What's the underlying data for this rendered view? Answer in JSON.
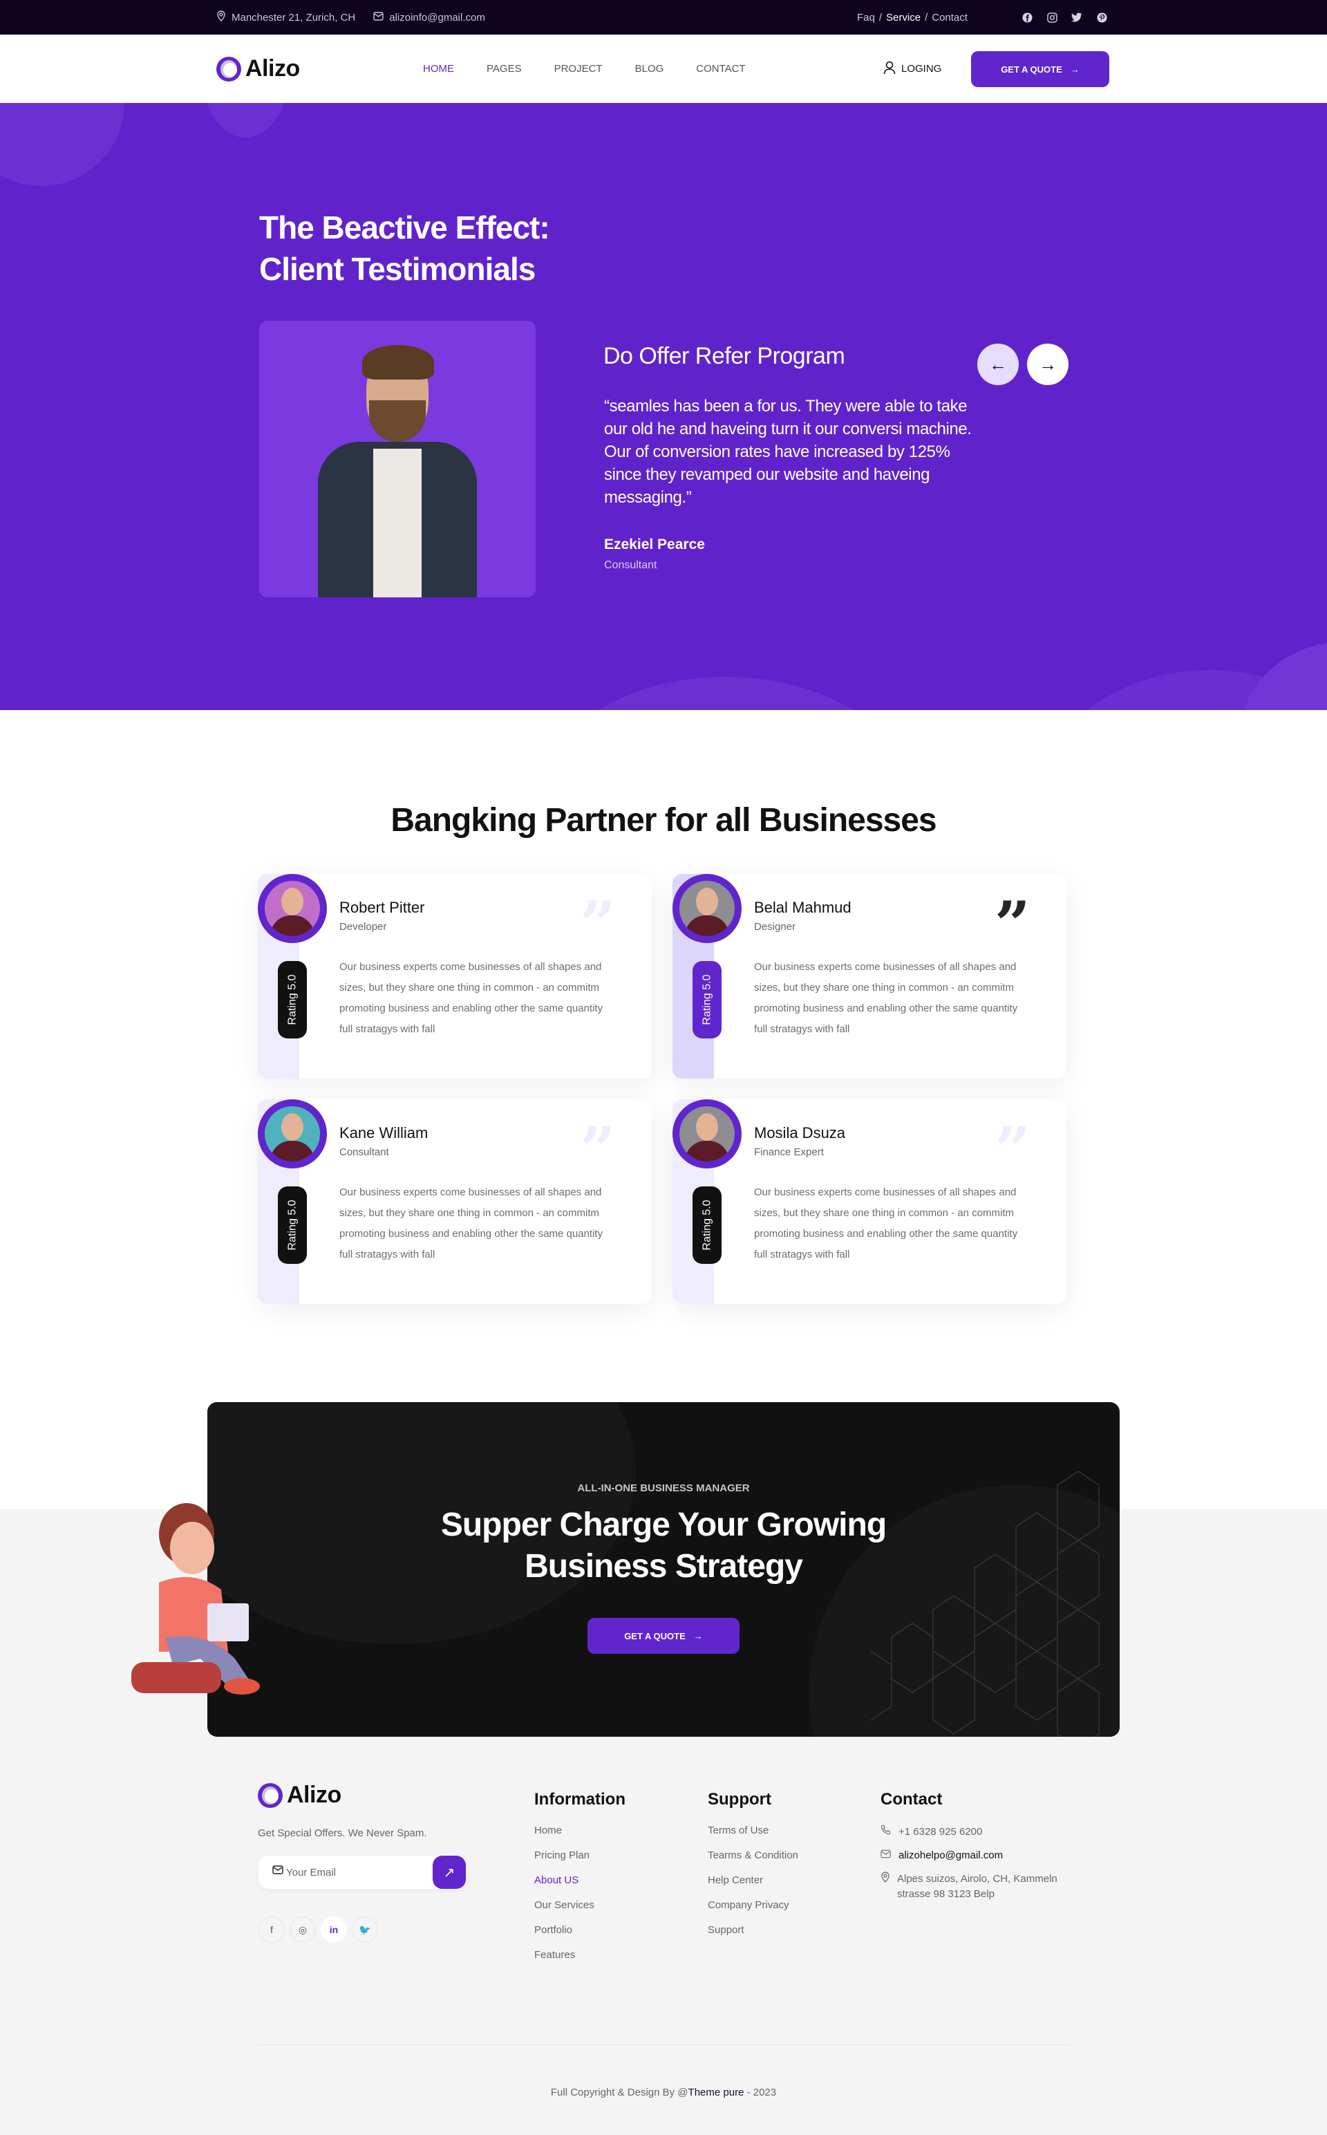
{
  "topbar": {
    "address": "Manchester 21, Zurich, CH",
    "email": "alizoinfo@gmail.com",
    "links": [
      {
        "label": "Faq",
        "active": false
      },
      {
        "label": "Service",
        "active": true
      },
      {
        "label": "Contact",
        "active": false
      }
    ],
    "separator": "/",
    "social_icons": [
      "facebook-icon",
      "instagram-icon",
      "twitter-icon",
      "pinterest-icon"
    ]
  },
  "header": {
    "logo": "Alizo",
    "nav": [
      {
        "label": "HOME",
        "active": true
      },
      {
        "label": "PAGES",
        "active": false
      },
      {
        "label": "PROJECT",
        "active": false
      },
      {
        "label": "BLOG",
        "active": false
      },
      {
        "label": "CONTACT",
        "active": false
      }
    ],
    "login_label": "LOGING",
    "quote_label": "GET A QUOTE"
  },
  "hero": {
    "title_line1": "The Beactive Effect:",
    "title_line2": "Client Testimonials",
    "prev_icon": "←",
    "next_icon": "→",
    "quote_title": "Do Offer Refer Program",
    "quote_text": "“seamles has been a for us. They were able to take our old he and haveing turn it our conversi machine. Our of conversion rates have increased by 125% since they revamped our website and haveing messaging.”",
    "author_name": "Ezekiel Pearce",
    "author_role": "Consultant"
  },
  "partners": {
    "title": "Bangking Partner for all Businesses",
    "cards": [
      {
        "name": "Robert Pitter",
        "role": "Developer",
        "rating": "Rating 5.0",
        "highlight": false,
        "body": "Our business experts come businesses of all shapes and sizes, but they share one thing in common - an commitm  promoting business and enabling other the same quantity full stratagys with fall"
      },
      {
        "name": "Belal Mahmud",
        "role": "Designer",
        "rating": "Rating 5.0",
        "highlight": true,
        "body": "Our business experts come businesses of all shapes and sizes, but they share one thing in common - an commitm  promoting business and enabling other the same quantity full stratagys with fall"
      },
      {
        "name": "Kane William",
        "role": "Consultant",
        "rating": "Rating 5.0",
        "highlight": false,
        "body": "Our business experts come businesses of all shapes and sizes, but they share one thing in common - an commitm  promoting business and enabling other the same quantity full stratagys with fall"
      },
      {
        "name": "Mosila Dsuza",
        "role": "Finance Expert",
        "rating": "Rating 5.0",
        "highlight": false,
        "body": "Our business experts come businesses of all shapes and sizes, but they share one thing in common - an commitm  promoting business and enabling other the same quantity full stratagys with fall"
      }
    ]
  },
  "cta": {
    "eyebrow": "ALL-IN-ONE BUSINESS MANAGER",
    "title_line1": "Supper Charge Your Growing",
    "title_line2": "Business Strategy",
    "button_label": "GET A QUOTE"
  },
  "footer": {
    "logo": "Alizo",
    "tagline": "Get Special Offers. We Never Spam.",
    "email_placeholder": "Your Email",
    "social": [
      {
        "label": "f",
        "icon": "facebook-icon",
        "active": false
      },
      {
        "label": "◎",
        "icon": "instagram-icon",
        "active": false
      },
      {
        "label": "in",
        "icon": "linkedin-icon",
        "active": true
      },
      {
        "label": "🐦",
        "icon": "twitter-icon",
        "active": false
      }
    ],
    "information": {
      "heading": "Information",
      "items": [
        {
          "label": "Home",
          "active": false
        },
        {
          "label": "Pricing Plan",
          "active": false
        },
        {
          "label": "About US",
          "active": true
        },
        {
          "label": "Our Services",
          "active": false
        },
        {
          "label": "Portfolio",
          "active": false
        },
        {
          "label": "Features",
          "active": false
        }
      ]
    },
    "support": {
      "heading": "Support",
      "items": [
        "Terms of Use",
        "Tearms & Condition",
        "Help Center",
        "Company Privacy",
        "Support"
      ]
    },
    "contact": {
      "heading": "Contact",
      "phone": "+1 6328 925 6200",
      "email": "alizohelpo@gmail.com",
      "address": "Alpes suizos, Airolo, CH, Kammeln strasse 98 3123 Belp"
    },
    "copyright_prefix": "Full Copyright & Design By @",
    "copyright_brand": "Theme pure",
    "copyright_suffix": " - 2023"
  },
  "colors": {
    "brand": "#6125cd",
    "topbar": "#0e041f",
    "hero_bg": "#6023cb",
    "cta_bg": "#111111",
    "footer_bg": "#f4f4f4"
  }
}
